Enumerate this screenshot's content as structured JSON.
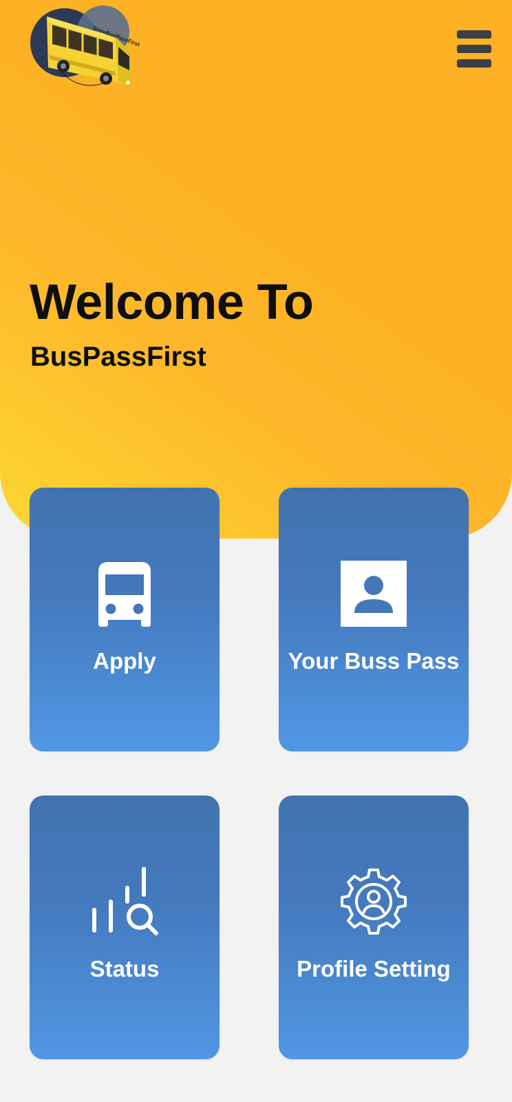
{
  "header": {
    "logo_caption": "ShowBusPassFirst",
    "menu_icon": "hamburger-menu-icon"
  },
  "hero": {
    "title": "Welcome To",
    "subtitle": "BusPassFirst"
  },
  "tiles": [
    {
      "label": "Apply",
      "icon": "bus-icon"
    },
    {
      "label": "Your Buss Pass",
      "icon": "user-card-icon"
    },
    {
      "label": "Status",
      "icon": "status-chart-search-icon"
    },
    {
      "label": "Profile Setting",
      "icon": "user-gear-icon"
    }
  ],
  "colors": {
    "hero_yellow": "#fdb124",
    "tile_blue_top": "#4173b0",
    "tile_blue_bottom": "#5197e5",
    "background": "#f2f2f2",
    "menu_icon": "#3b3f48"
  }
}
